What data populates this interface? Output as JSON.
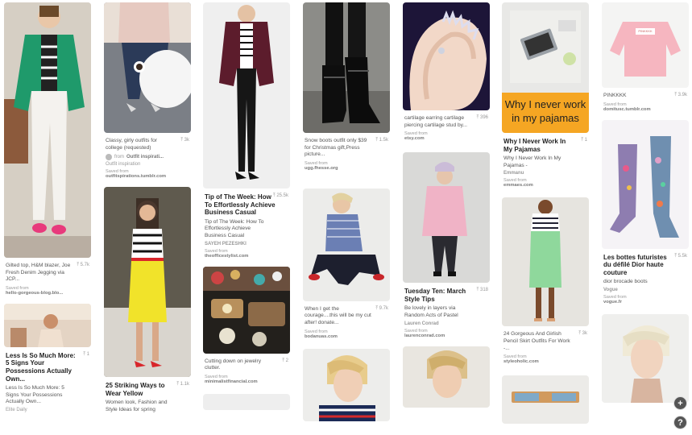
{
  "pins": {
    "p1": {
      "desc": "Gilted top, H&M blazer, Joe Fresh Denim Jegging via JCP...",
      "saves": "5.7k",
      "saved_from": "Saved from",
      "source": "hello-gorgeous-blog.blo..."
    },
    "p2": {
      "title": "Less Is So Much More: 5 Signs Your Possessions Actually Own...",
      "saves": "1",
      "desc": "Less Is So Much More: 5 Signs Your Possessions Actually Own...",
      "board": "Elite Daily"
    },
    "p3": {
      "desc": "Classy, girly outfits for college (requested)",
      "saves": "3k",
      "board_from": "from",
      "board": "Outfit inspirati...",
      "board_sub": "Outfit inspiration",
      "saved_from": "Saved from",
      "source": "outfitspirations.tumblr.com"
    },
    "p4": {
      "title": "25 Striking Ways to Wear Yellow",
      "saves": "1.1k",
      "desc": "Women look, Fashion and Style Ideas for spring"
    },
    "p5": {
      "title": "Tip of The Week: How To Effortlessly Achieve Business Casual",
      "saves": "25.5k",
      "desc": "Tip of The Week: How To Effortlessly Achieve Business Casual",
      "board": "SAYEH PEZESHKI",
      "saved_from": "Saved from",
      "source": "theofficestylist.com"
    },
    "p6": {
      "desc": "Cutting down on jewelry clutter.",
      "saves": "2",
      "saved_from": "Saved from",
      "source": "minimalistfinancial.com"
    },
    "p7": {
      "desc": "Snow boots outfit only $39 for Christmas gift,Press picture...",
      "saves": "1.5k",
      "saved_from": "Saved from",
      "source": "ugg.fhesse.org"
    },
    "p8": {
      "desc": "When I get the courage....this will be my cut after! donate...",
      "saves": "9.7k",
      "saved_from": "Saved from",
      "source": "bodanuas.com"
    },
    "p9": {
      "desc": "cartilage earring cartilage piercing cartilage stud by...",
      "saves": "396",
      "saved_from": "Saved from",
      "source": "etsy.com"
    },
    "p10": {
      "title": "Tuesday Ten: March Style Tips",
      "saves": "318",
      "desc": "Be lovely in layers via Random Acts of Pastel",
      "board": "Lauren Conrad",
      "saved_from": "Saved from",
      "source": "laurenconrad.com"
    },
    "p11": {
      "image_text": "Why I never work in my pajamas",
      "title": "Why I Never Work In My Pajamas",
      "saves": "1",
      "desc": "Why I Never Work In My Pajamas -",
      "board": "Emmanu",
      "saved_from": "Saved from",
      "source": "emmaes.com"
    },
    "p12": {
      "desc": "24 Gorgeous And Girlish Pencil Skirt Outfits For Work -...",
      "saves": "3k",
      "saved_from": "Saved from",
      "source": "styleoholic.com"
    },
    "p13": {
      "image_text": "PINKKKK",
      "desc": "PINKKKK",
      "saves": "3.9k",
      "saved_from": "Saved from",
      "source": "domitusc.tumblr.com"
    },
    "p14": {
      "title": "Les bottes futuristes du défilé Dior haute couture",
      "saves": "5.5k",
      "desc": "dior brocade boots",
      "board": "Vogue",
      "saved_from": "Saved from",
      "source": "vogue.fr"
    }
  },
  "fab": {
    "add": "+",
    "help": "?"
  },
  "colors": {
    "accent": "#f5a623",
    "brand": "#e60023",
    "page_bg": "#ffffff"
  }
}
